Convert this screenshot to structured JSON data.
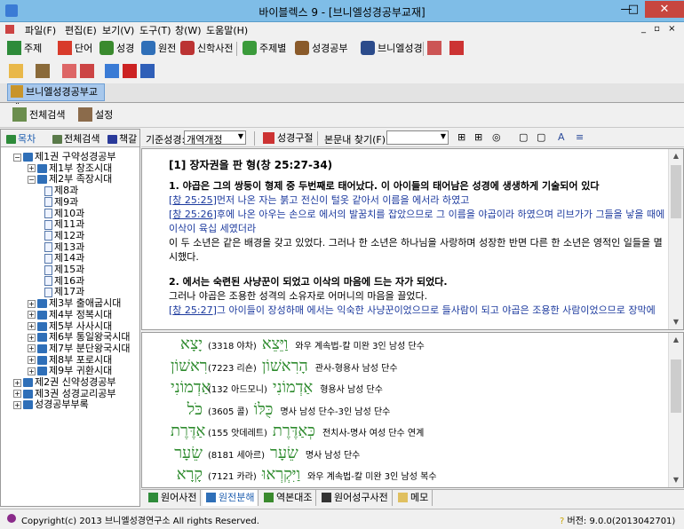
{
  "window": {
    "title": "바이블렉스 9 - [브니엘성경공부교재]",
    "minimize": "—",
    "maximize": "□",
    "close": "✕"
  },
  "menu": {
    "items": [
      "파일(F)",
      "편집(E)",
      "보기(V)",
      "도구(T)",
      "창(W)",
      "도움말(H)"
    ],
    "right": "_ ▫ ×"
  },
  "toolbar1": {
    "buttons": [
      "주제",
      "단어",
      "성경",
      "원전",
      "신학사전",
      "주제별",
      "성경공부",
      "브니엘성경"
    ]
  },
  "tab": {
    "label": "브니엘성경공부교재"
  },
  "subbar": {
    "search": "전체검색",
    "settings": "설정"
  },
  "sidebar": {
    "tabs": [
      "목차",
      "전체검색",
      "책갈"
    ],
    "tree": [
      {
        "label": "제1권 구약성경공부",
        "indent": 0,
        "toggle": "−",
        "kind": "book"
      },
      {
        "label": "제1부 창조시대",
        "indent": 1,
        "toggle": "+",
        "kind": "book"
      },
      {
        "label": "제2부 족장시대",
        "indent": 1,
        "toggle": "−",
        "kind": "book"
      },
      {
        "label": "제8과",
        "indent": 2,
        "toggle": "",
        "kind": "page"
      },
      {
        "label": "제9과",
        "indent": 2,
        "toggle": "",
        "kind": "page"
      },
      {
        "label": "제10과",
        "indent": 2,
        "toggle": "",
        "kind": "page"
      },
      {
        "label": "제11과",
        "indent": 2,
        "toggle": "",
        "kind": "page"
      },
      {
        "label": "제12과",
        "indent": 2,
        "toggle": "",
        "kind": "page"
      },
      {
        "label": "제13과",
        "indent": 2,
        "toggle": "",
        "kind": "page"
      },
      {
        "label": "제14과",
        "indent": 2,
        "toggle": "",
        "kind": "page"
      },
      {
        "label": "제15과",
        "indent": 2,
        "toggle": "",
        "kind": "page"
      },
      {
        "label": "제16과",
        "indent": 2,
        "toggle": "",
        "kind": "page"
      },
      {
        "label": "제17과",
        "indent": 2,
        "toggle": "",
        "kind": "page"
      },
      {
        "label": "제3부 출애굽시대",
        "indent": 1,
        "toggle": "+",
        "kind": "book"
      },
      {
        "label": "제4부 정복시대",
        "indent": 1,
        "toggle": "+",
        "kind": "book"
      },
      {
        "label": "제5부 사사시대",
        "indent": 1,
        "toggle": "+",
        "kind": "book"
      },
      {
        "label": "제6부 통일왕국시대",
        "indent": 1,
        "toggle": "+",
        "kind": "book"
      },
      {
        "label": "제7부 분단왕국시대",
        "indent": 1,
        "toggle": "+",
        "kind": "book"
      },
      {
        "label": "제8부 포로시대",
        "indent": 1,
        "toggle": "+",
        "kind": "book"
      },
      {
        "label": "제9부 귀환시대",
        "indent": 1,
        "toggle": "+",
        "kind": "book"
      },
      {
        "label": "제2권 신약성경공부",
        "indent": 0,
        "toggle": "+",
        "kind": "book"
      },
      {
        "label": "제3권 성경교리공부",
        "indent": 0,
        "toggle": "+",
        "kind": "book"
      },
      {
        "label": "성경공부부록",
        "indent": 0,
        "toggle": "+",
        "kind": "book"
      }
    ]
  },
  "main_toolbar": {
    "version_label": "기준성경:",
    "version_value": "개역개정",
    "compare": "성경구절",
    "find_label": "본문내 찾기(F):",
    "find_value": ""
  },
  "content": {
    "heading": "[1] 장자권을 판 형(창 25:27-34)",
    "sec1_title": "1. 야곱은 그의 쌍둥이 형제 중 두번째로 태어났다. 이 아이들의 태어남은 성경에 생생하게 기술되어 있다",
    "v1_ref": "창 25:25",
    "v1_text": "먼저 나온 자는 붉고 전신이 털옷 같아서 이름을 에서라 하였고",
    "v2_ref": "창 25:26",
    "v2_text": "후에 나온 아우는 손으로 에서의 발꿈치를 잡았으므로 그 이름을 야곱이라 하였으며 리브가가 그들을 낳을 때에 이삭이 육십 세였더라",
    "p1": "이 두 소년은 같은 배경을 갖고 있었다. 그러나 한 소년은 하나님을 사랑하며 성장한 반면 다른 한 소년은 영적인 일들을 멸시했다.",
    "sec2_title": "2. 에서는 숙련된 사냥꾼이 되었고 이삭의 마음에 드는 자가 되었다.",
    "p2": "그러나 야곱은 조용한 성격의 소유자로 어머니의 마음을 끌었다.",
    "v3_ref": "창 25:27",
    "v3_text": "그 아이들이 장성하매 에서는 익숙한 사냥꾼이었으므로 들사람이 되고 야곱은 조용한 사람이었으므로 장막에"
  },
  "hebrew": [
    {
      "word1": "יָצָא",
      "word2": "וַיֵּצֵא",
      "strong": "(3318 야차)",
      "desc": "와우 계속법-칼 미완 3인 남성 단수"
    },
    {
      "word1": "רִאשׁוֹן",
      "word2": "הָרִאשׁוֹן",
      "strong": "(7223 리숀)",
      "desc": "관사-형용사 남성 단수"
    },
    {
      "word1": "אַדְמוֹנִי",
      "word2": "אַדְמוֹנִי",
      "strong": "(132 아드모니)",
      "desc": "형용사 남성 단수"
    },
    {
      "word1": "כֹּל",
      "word2": "כֻּלּוֹ",
      "strong": "(3605 콜)",
      "desc": "명사 남성 단수-3인 남성 단수"
    },
    {
      "word1": "אַדֶּרֶת",
      "word2": "כְּאַדֶּרֶת",
      "strong": "(155 앗데레트)",
      "desc": "전치사-명사 여성 단수 연계"
    },
    {
      "word1": "שֵׂעָר",
      "word2": "שֵׂעָר",
      "strong": "(8181 세아르)",
      "desc": "명사 남성 단수"
    },
    {
      "word1": "קָרָא",
      "word2": "וַיִּקְרְאוּ",
      "strong": "(7121 카라)",
      "desc": "와우 계속법-칼 미완 3인 남성 복수"
    }
  ],
  "bottom_tabs": [
    "원어사전",
    "원전분해",
    "역본대조",
    "원어성구사전",
    "메모"
  ],
  "status": {
    "copyright": "Copyright(c) 2013 브니엘성경연구소 All rights Reserved.",
    "version": "버전: 9.0.0(2013042701)"
  },
  "colors": {
    "titlebar": "#7fbde7",
    "hebrew": "#2d8a2d",
    "verse": "#1c3a9e",
    "close": "#c7463f"
  }
}
